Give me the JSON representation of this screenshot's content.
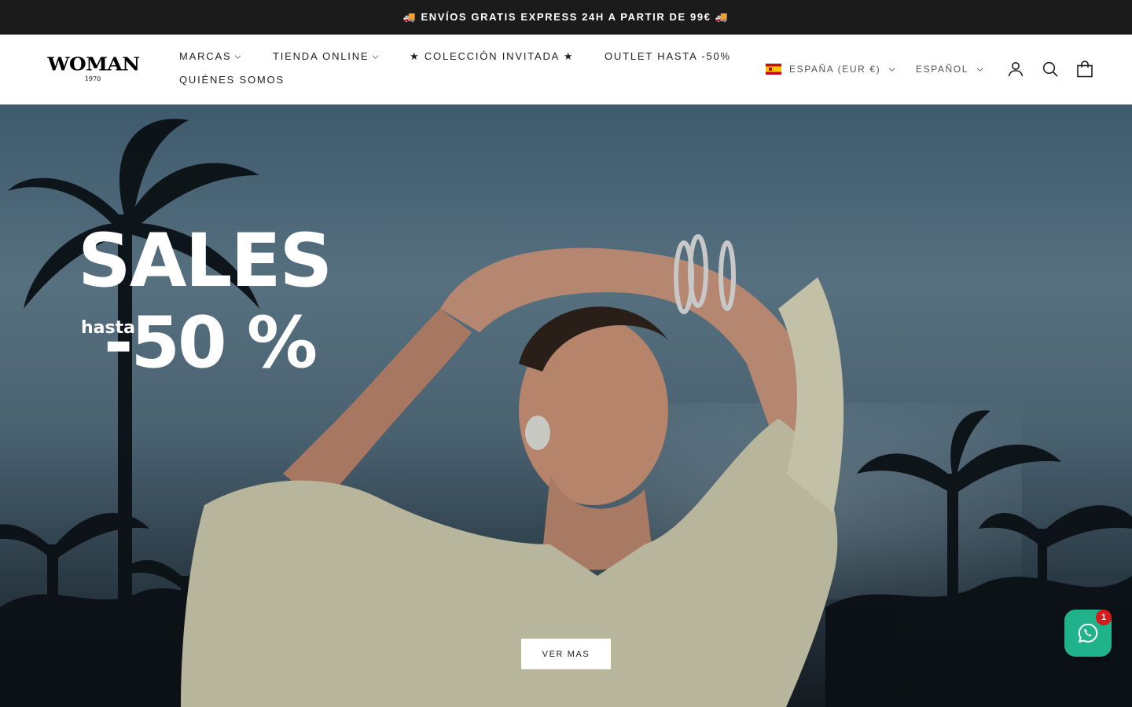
{
  "announcement": {
    "text": "🚚 ENVÍOS GRATIS EXPRESS 24H A PARTIR DE 99€ 🚚"
  },
  "header": {
    "logo": {
      "word": "WOMAN",
      "year": "1970"
    },
    "nav": [
      {
        "label": "MARCAS",
        "has_dropdown": true
      },
      {
        "label": "TIENDA ONLINE",
        "has_dropdown": true
      },
      {
        "label": "★ COLECCIÓN INVITADA ★",
        "has_dropdown": false
      },
      {
        "label": "OUTLET HASTA -50%",
        "has_dropdown": false
      },
      {
        "label": "QUIÉNES SOMOS",
        "has_dropdown": false
      }
    ],
    "country_selector": {
      "label": "ESPAÑA (EUR €)",
      "flag": "spain-flag"
    },
    "language_selector": {
      "label": "ESPAÑOL"
    },
    "icons": [
      "account-icon",
      "search-icon",
      "cart-icon"
    ]
  },
  "hero": {
    "title": "SALES",
    "prefix": "hasta",
    "discount": "-50 %",
    "cta_label": "VER MAS"
  },
  "whatsapp": {
    "icon": "whatsapp-icon",
    "badge_count": "1",
    "color": "#20b28a"
  },
  "colors": {
    "announcement_bg": "#1b1b1b",
    "header_bg": "#ffffff",
    "badge": "#d7181c"
  }
}
